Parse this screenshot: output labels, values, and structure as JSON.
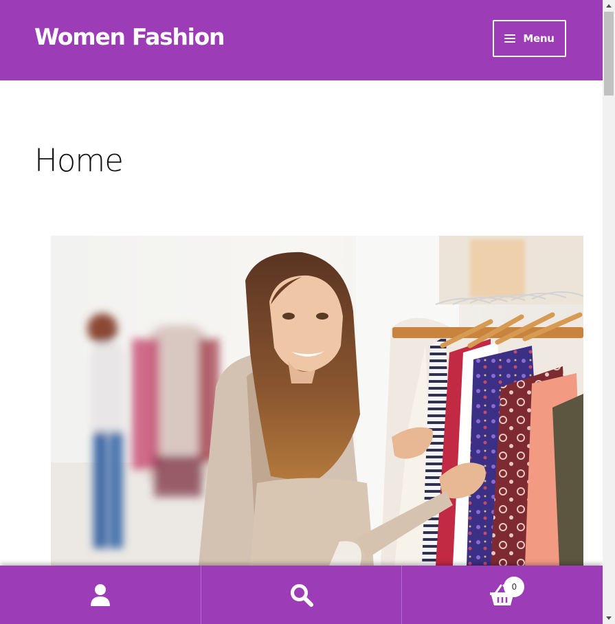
{
  "header": {
    "site_title": "Women Fashion",
    "menu_label": "Menu",
    "menu_icon": "hamburger-icon",
    "background_color": "#9c3db7"
  },
  "main": {
    "page_title": "Home",
    "hero_image": "woman-shopping-clothes-rack-photo"
  },
  "footer_bar": {
    "background_color": "#9c3db7",
    "items": [
      {
        "icon": "user-icon"
      },
      {
        "icon": "search-icon"
      },
      {
        "icon": "cart-icon",
        "count": "0"
      }
    ]
  },
  "scrollbar": {
    "up_icon": "arrow-up-icon",
    "down_icon": "arrow-down-icon"
  }
}
